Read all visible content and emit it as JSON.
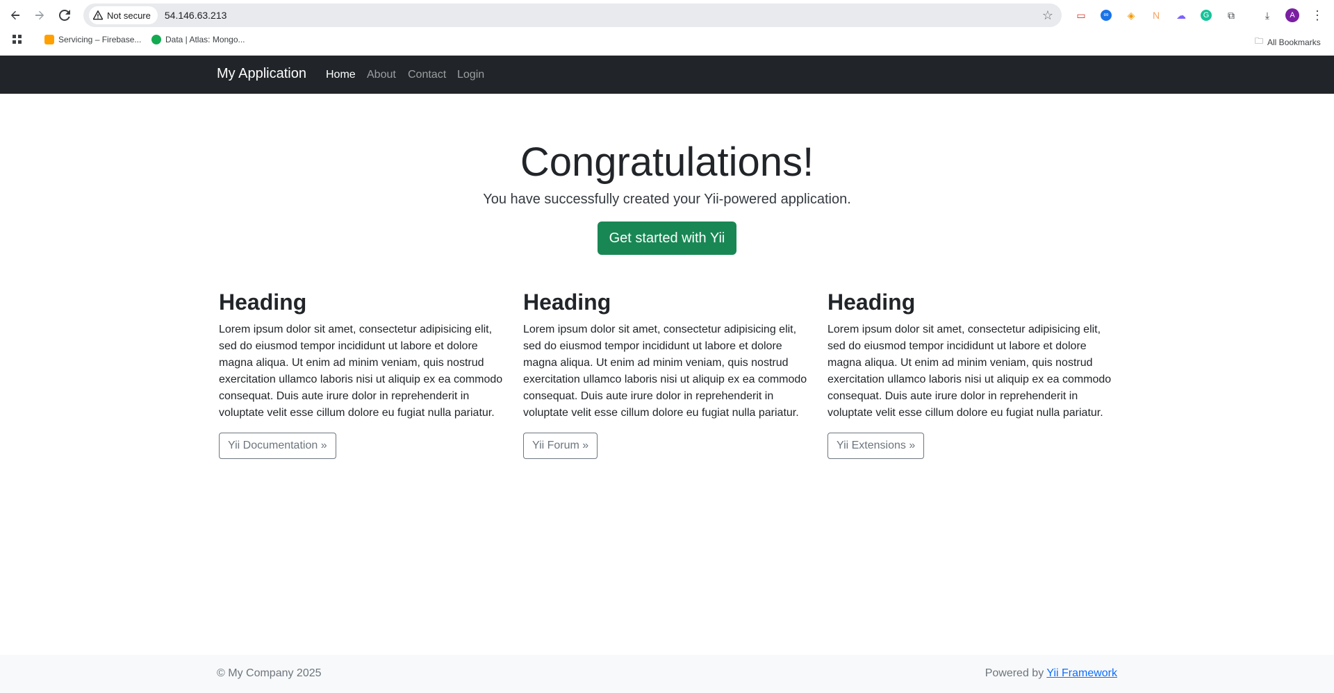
{
  "browser": {
    "security_label": "Not secure",
    "url": "54.146.63.213",
    "bookmarks": [
      {
        "label": "Servicing – Firebase..."
      },
      {
        "label": "Data | Atlas: Mongo..."
      }
    ],
    "all_bookmarks_label": "All Bookmarks",
    "profile_initial": "A"
  },
  "nav": {
    "brand": "My Application",
    "links": [
      {
        "label": "Home"
      },
      {
        "label": "About"
      },
      {
        "label": "Contact"
      },
      {
        "label": "Login"
      }
    ]
  },
  "hero": {
    "title": "Congratulations!",
    "lead": "You have successfully created your Yii-powered application.",
    "button": "Get started with Yii"
  },
  "columns": [
    {
      "heading": "Heading",
      "text": "Lorem ipsum dolor sit amet, consectetur adipisicing elit, sed do eiusmod tempor incididunt ut labore et dolore magna aliqua. Ut enim ad minim veniam, quis nostrud exercitation ullamco laboris nisi ut aliquip ex ea commodo consequat. Duis aute irure dolor in reprehenderit in voluptate velit esse cillum dolore eu fugiat nulla pariatur.",
      "button": "Yii Documentation »"
    },
    {
      "heading": "Heading",
      "text": "Lorem ipsum dolor sit amet, consectetur adipisicing elit, sed do eiusmod tempor incididunt ut labore et dolore magna aliqua. Ut enim ad minim veniam, quis nostrud exercitation ullamco laboris nisi ut aliquip ex ea commodo consequat. Duis aute irure dolor in reprehenderit in voluptate velit esse cillum dolore eu fugiat nulla pariatur.",
      "button": "Yii Forum »"
    },
    {
      "heading": "Heading",
      "text": "Lorem ipsum dolor sit amet, consectetur adipisicing elit, sed do eiusmod tempor incididunt ut labore et dolore magna aliqua. Ut enim ad minim veniam, quis nostrud exercitation ullamco laboris nisi ut aliquip ex ea commodo consequat. Duis aute irure dolor in reprehenderit in voluptate velit esse cillum dolore eu fugiat nulla pariatur.",
      "button": "Yii Extensions »"
    }
  ],
  "footer": {
    "copyright": "© My Company 2025",
    "powered_prefix": "Powered by ",
    "powered_link": "Yii Framework"
  },
  "colors": {
    "navbar": "#212529",
    "primary_button": "#198754",
    "footer_bg": "#f8f9fa",
    "link": "#0d6efd"
  }
}
